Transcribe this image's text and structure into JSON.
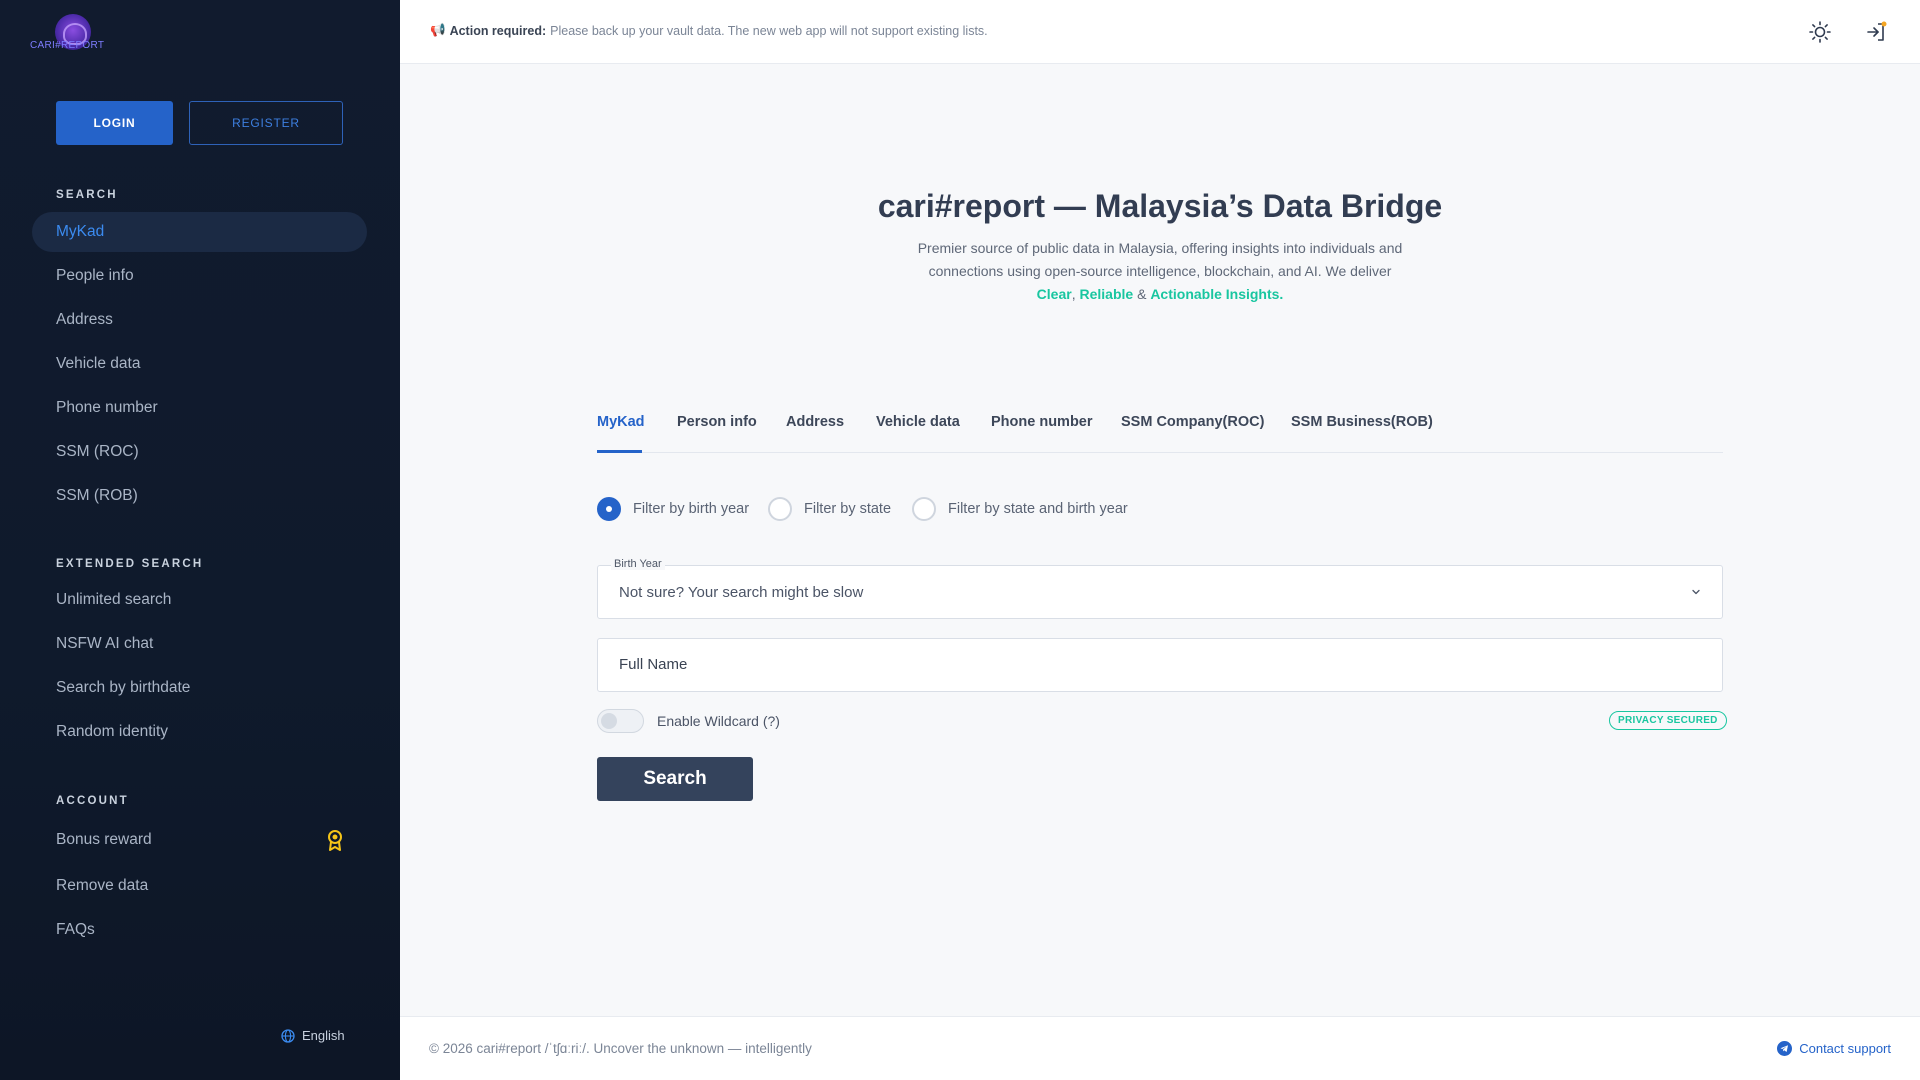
{
  "brand": {
    "logo_text": "CARI#REPORT"
  },
  "auth": {
    "login_label": "LOGIN",
    "register_label": "REGISTER"
  },
  "sidebar": {
    "search_title": "SEARCH",
    "search_items": [
      {
        "label": "MyKad",
        "active": true
      },
      {
        "label": "People info"
      },
      {
        "label": "Address"
      },
      {
        "label": "Vehicle data"
      },
      {
        "label": "Phone number"
      },
      {
        "label": "SSM (ROC)"
      },
      {
        "label": "SSM (ROB)"
      }
    ],
    "extended_title": "EXTENDED SEARCH",
    "extended_items": [
      {
        "label": "Unlimited search"
      },
      {
        "label": "NSFW AI chat"
      },
      {
        "label": "Search by birthdate"
      },
      {
        "label": "Random identity"
      }
    ],
    "account_title": "ACCOUNT",
    "account_items": [
      {
        "label": "Bonus reward",
        "icon": "award-icon"
      },
      {
        "label": "Remove data"
      },
      {
        "label": "FAQs"
      }
    ],
    "language": "English"
  },
  "topbar": {
    "notice_icon": "📢",
    "notice_bold": "Action required:",
    "notice_text": "Please back up your vault data. The new web app will not support existing lists.",
    "icons": [
      "sun-icon",
      "login-icon"
    ]
  },
  "hero": {
    "title": "cari#report — Malaysia’s Data Bridge",
    "desc": "Premier source of public data in Malaysia, offering insights into individuals and connections using open-source intelligence, blockchain, and AI. We deliver",
    "hl_clear": "Clear",
    "sep1": ", ",
    "hl_reliable": "Reliable",
    "sep2": " & ",
    "hl_actionable": "Actionable Insights."
  },
  "tabs": [
    "MyKad",
    "Person info",
    "Address",
    "Vehicle data",
    "Phone number",
    "SSM Company(ROC)",
    "SSM Business(ROB)"
  ],
  "filters": [
    "Filter by birth year",
    "Filter by state",
    "Filter by state and birth year"
  ],
  "form": {
    "birth_year_label": "Birth Year",
    "birth_year_value": "Not sure? Your search might be slow",
    "full_name_placeholder": "Full Name",
    "wildcard_label": "Enable Wildcard (?)",
    "privacy_badge": "PRIVACY SECURED",
    "search_label": "Search"
  },
  "footer": {
    "text": "© 2026 cari#report /ˈtʃɑːriː/. Uncover the unknown — intelligently",
    "support_label": "Contact support"
  },
  "colors": {
    "accent": "#2563c9",
    "highlight": "#19c6a0",
    "sidebar_bg": "#111b2e",
    "search_button": "#34435c"
  }
}
